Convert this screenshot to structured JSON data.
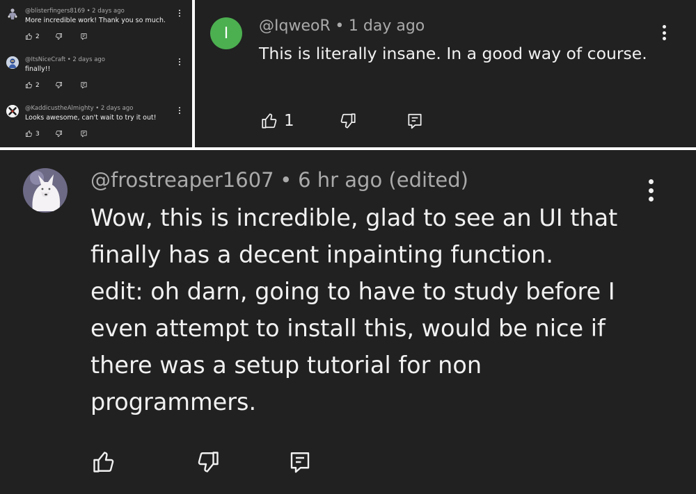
{
  "colors": {
    "background": "#212121",
    "text_primary": "#f1f1f1",
    "text_secondary": "#aaaaaa",
    "separator": "#ffffff",
    "iqweor_avatar": "#4caf50"
  },
  "panel_a": {
    "comments": [
      {
        "author": "@blisterfingers8169",
        "time": "2 days ago",
        "text": "More incredible work! Thank you so much.",
        "likes": "2",
        "avatar_icon": "figure-avatar-icon"
      },
      {
        "author": "@ItsNiceCraft",
        "time": "2 days ago",
        "text": "finally!!",
        "likes": "2",
        "avatar_icon": "blue-character-avatar-icon"
      },
      {
        "author": "@KaddicustheAlmighty",
        "time": "2 days ago",
        "text": "Looks awesome, can't wait to try it out!",
        "likes": "3",
        "avatar_icon": "x-badge-avatar-icon"
      }
    ]
  },
  "panel_b": {
    "author": "@IqweoR",
    "time": "1 day ago",
    "avatar_letter": "I",
    "text": "This is literally insane. In a good way of course.",
    "likes": "1"
  },
  "panel_c": {
    "author": "@frostreaper1607",
    "time": "6 hr ago (edited)",
    "avatar_icon": "white-wolf-avatar-icon",
    "text_lines": [
      "Wow, this is incredible, glad to see an UI that",
      "finally has a decent inpainting function.",
      "edit: oh darn, going to have to study before I",
      "even attempt to install this, would be nice if",
      "there was a setup tutorial for non",
      "programmers."
    ]
  },
  "icons": {
    "like": "thumbs-up-icon",
    "dislike": "thumbs-down-icon",
    "reply": "reply-icon",
    "more": "more-vertical-icon"
  }
}
